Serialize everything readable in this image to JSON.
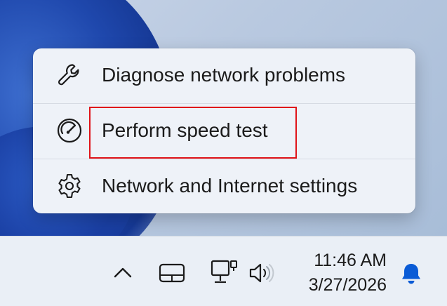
{
  "menu": {
    "items": [
      {
        "label": "Diagnose network problems",
        "icon": "wrench-icon"
      },
      {
        "label": "Perform speed test",
        "icon": "speedometer-icon"
      },
      {
        "label": "Network and Internet settings",
        "icon": "gear-icon"
      }
    ]
  },
  "taskbar": {
    "tray_icons": [
      "chevron-up-icon",
      "touchpad-icon",
      "network-icon",
      "volume-icon"
    ],
    "time": "11:46 AM",
    "date": "3/27/2026",
    "notification_icon": "bell-icon"
  },
  "colors": {
    "highlight_border": "#e0141a",
    "accent": "#0a5bd6"
  }
}
